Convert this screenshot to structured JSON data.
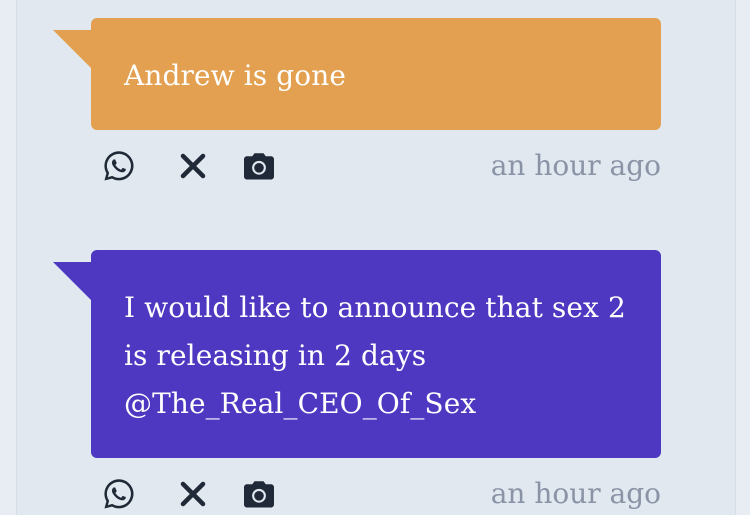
{
  "posts": [
    {
      "message": "Andrew is gone",
      "bubble_color": "#e3a050",
      "timestamp": "an hour ago",
      "actions": [
        {
          "icon": "whatsapp-icon"
        },
        {
          "icon": "x-close-icon"
        },
        {
          "icon": "camera-icon"
        }
      ]
    },
    {
      "message_lines": [
        "I would like to announce that sex 2",
        "is releasing in 2 days",
        "@The_Real_CEO_Of_Sex"
      ],
      "bubble_color": "#4f38c1",
      "timestamp": "an hour ago",
      "actions": [
        {
          "icon": "whatsapp-icon"
        },
        {
          "icon": "x-close-icon"
        },
        {
          "icon": "camera-icon"
        }
      ]
    }
  ],
  "colors": {
    "background": "#e2e8f0",
    "timestamp": "#8a94a6",
    "icon": "#1f2937"
  }
}
